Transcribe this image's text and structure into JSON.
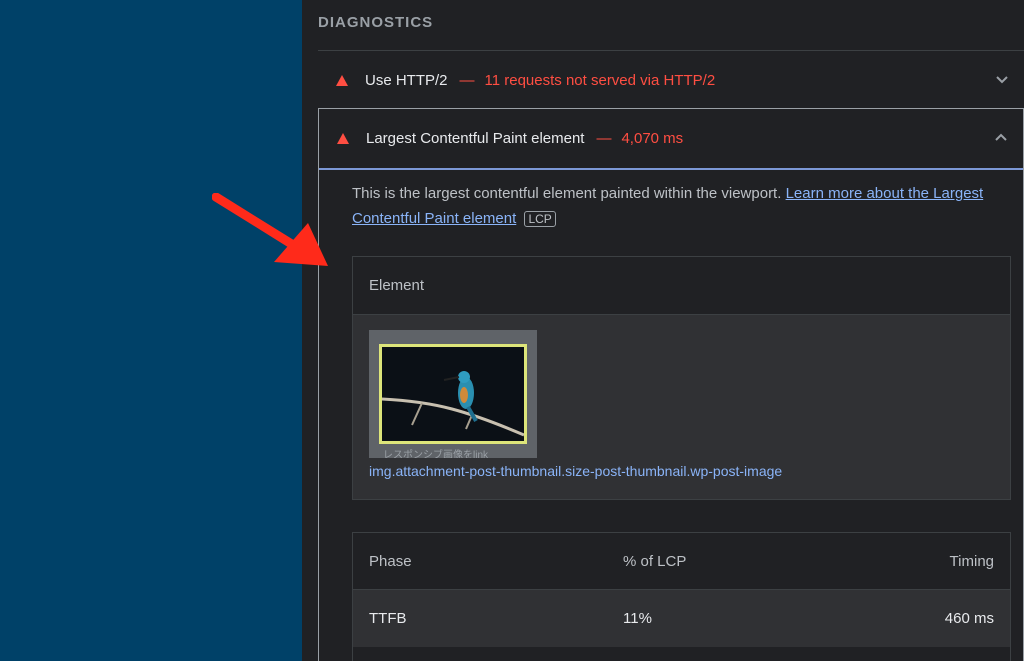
{
  "section": {
    "title": "DIAGNOSTICS"
  },
  "audits": [
    {
      "title": "Use HTTP/2",
      "separator": "—",
      "display": "11 requests not served via HTTP/2",
      "icon": "fail-triangle-icon",
      "expanded": false
    },
    {
      "title": "Largest Contentful Paint element",
      "separator": "—",
      "display": "4,070 ms",
      "icon": "fail-triangle-icon",
      "expanded": true
    }
  ],
  "description": {
    "text": "This is the largest contentful element painted within the viewport. ",
    "link": "Learn more about the Largest Contentful Paint element",
    "badge": "LCP"
  },
  "element_table": {
    "header": "Element",
    "thumbnail_caption": "レスポンシブ画像をlink",
    "selector_tag": "img",
    "selector_rest": ".attachment-post-thumbnail.size-post-thumbnail.wp-post-image"
  },
  "phase_table": {
    "headers": [
      "Phase",
      "% of LCP",
      "Timing"
    ],
    "rows": [
      {
        "phase": "TTFB",
        "percent": "11%",
        "timing": "460 ms"
      }
    ]
  },
  "colors": {
    "fail": "#ff4e42",
    "link": "#8ab4f8",
    "left_pane": "#004168",
    "arrow": "#ff2a1a"
  }
}
